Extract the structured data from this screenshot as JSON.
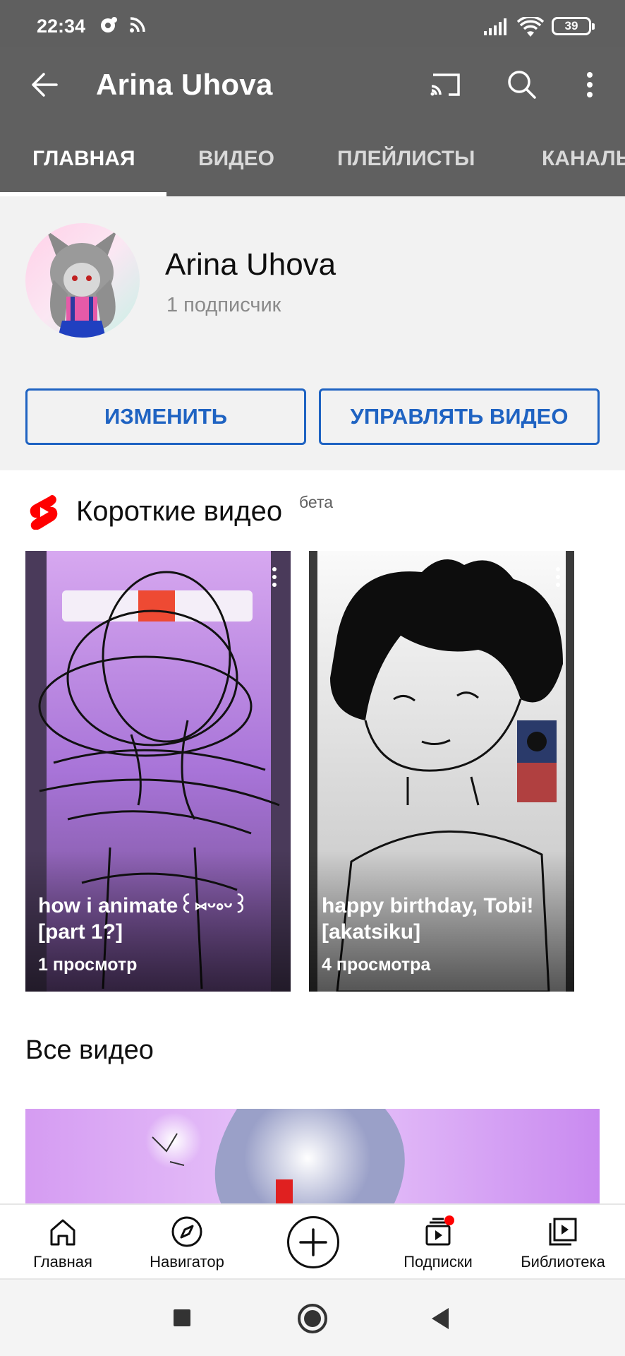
{
  "status_bar": {
    "time": "22:34",
    "battery": "39",
    "icons": [
      "notification-icon",
      "hotspot-icon",
      "signal-icon",
      "wifi-icon",
      "battery-icon"
    ]
  },
  "app_bar": {
    "title": "Arina Uhova",
    "icons": [
      "back-arrow-icon",
      "cast-icon",
      "search-icon",
      "more-vert-icon"
    ]
  },
  "tabs": [
    {
      "label": "ГЛАВНАЯ",
      "active": true
    },
    {
      "label": "ВИДЕО",
      "active": false
    },
    {
      "label": "ПЛЕЙЛИСТЫ",
      "active": false
    },
    {
      "label": "КАНАЛЫ",
      "active": false
    }
  ],
  "channel": {
    "name": "Arina Uhova",
    "subscribers": "1 подписчик",
    "edit_button": "ИЗМЕНИТЬ",
    "manage_button": "УПРАВЛЯТЬ ВИДЕО"
  },
  "shorts": {
    "title": "Короткие видео",
    "badge": "бета",
    "items": [
      {
        "title": "how i animate꒰⑅ᵕ༚ᵕ꒱ [part 1?]",
        "views": "1 просмотр"
      },
      {
        "title": "happy birthday, Tobi! [akatsiku]",
        "views": "4 просмотра"
      }
    ]
  },
  "all_videos": {
    "title": "Все видео"
  },
  "bottom_nav": [
    {
      "label": "Главная",
      "icon": "home-icon"
    },
    {
      "label": "Навигатор",
      "icon": "compass-icon"
    },
    {
      "label": "",
      "icon": "create-plus-icon"
    },
    {
      "label": "Подписки",
      "icon": "subscriptions-icon",
      "badge": true
    },
    {
      "label": "Библиотека",
      "icon": "library-icon"
    }
  ],
  "colors": {
    "app_bar": "#606060",
    "accent_blue": "#1f63c2",
    "shorts_red": "#ff0000"
  }
}
